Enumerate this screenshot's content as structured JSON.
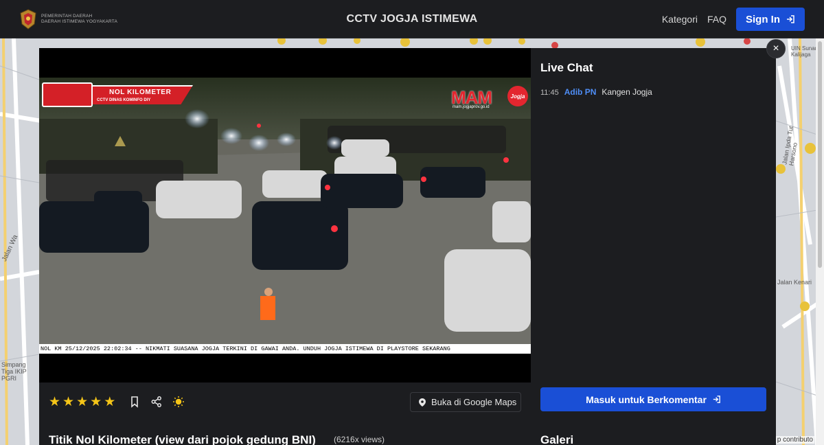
{
  "header": {
    "brand_lines": [
      "PEMERINTAH DAERAH",
      "DAERAH ISTIMEWA YOGYAKARTA"
    ],
    "title": "CCTV JOGJA ISTIMEWA",
    "nav": {
      "kategori": "Kategori",
      "faq": "FAQ",
      "signin": "Sign In"
    }
  },
  "map": {
    "labels": [
      "Jalan Wa",
      "Simpang Tiga IKIP PGRI",
      "Jalan Kenari",
      "Jalan Ipda Tut Harsono",
      "UIN Sunan Kalijaga"
    ],
    "attribution": "p contributo"
  },
  "modal": {
    "close_glyph": "×",
    "video": {
      "badge_title": "NOL KILOMETER",
      "badge_sub": "CCTV DINAS KOMINFO DIY",
      "mam_word": "MAM",
      "mam_circle": "Jogja",
      "mam_url": "mam.jogjaprov.go.id",
      "ticker": "NOL KM 25/12/2025 22:02:34 -- NIKMATI SUASANA JOGJA TERKINI DI GAWAI ANDA. UNDUH JOGJA ISTIMEWA DI PLAYSTORE SEKARANG"
    },
    "rating": {
      "stars": 5,
      "max": 5,
      "star_glyph": "★"
    },
    "maps_button": "Buka di Google Maps",
    "camera_name": "Titik Nol Kilometer (view dari pojok gedung BNI)",
    "views": "(6216x views)",
    "chat": {
      "title": "Live Chat",
      "messages": [
        {
          "time": "11:45",
          "user": "Adib PN",
          "text": "Kangen Jogja"
        }
      ],
      "comment_button": "Masuk untuk Berkomentar"
    },
    "gallery_title": "Galeri"
  },
  "colors": {
    "background": "#1c1d20",
    "accent": "#1a4fd6",
    "star": "#f5c518",
    "chat_user": "#4f8ef7",
    "badge_red": "#d42027"
  }
}
